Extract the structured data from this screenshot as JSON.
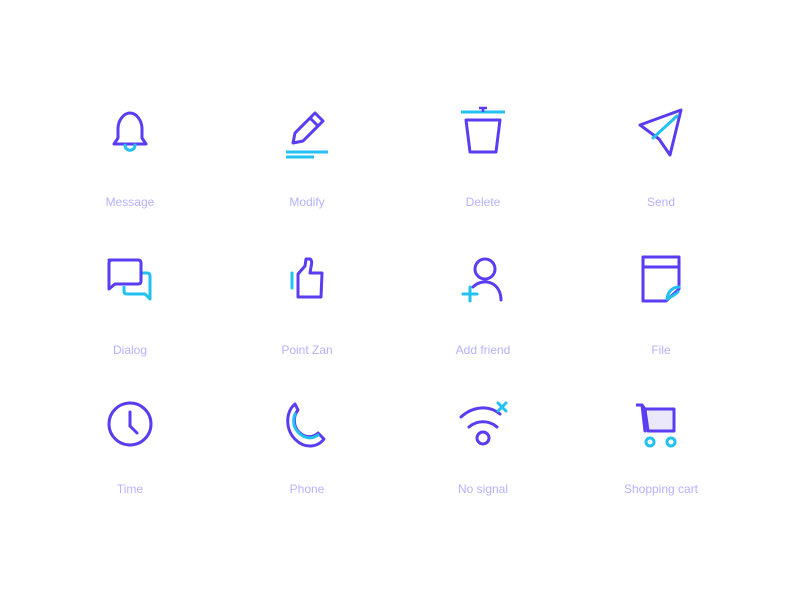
{
  "colors": {
    "primary": "#5a3cf2",
    "accent": "#22c1f1",
    "label": "#b6b1ff",
    "background": "#ffffff"
  },
  "icons": [
    {
      "icon": "bell-icon",
      "label": "Message"
    },
    {
      "icon": "pencil-icon",
      "label": "Modify"
    },
    {
      "icon": "trash-icon",
      "label": "Delete"
    },
    {
      "icon": "paper-plane-icon",
      "label": "Send"
    },
    {
      "icon": "chat-bubbles-icon",
      "label": "Dialog"
    },
    {
      "icon": "thumbs-up-icon",
      "label": "Point Zan"
    },
    {
      "icon": "add-user-icon",
      "label": "Add friend"
    },
    {
      "icon": "file-icon",
      "label": "File"
    },
    {
      "icon": "clock-icon",
      "label": "Time"
    },
    {
      "icon": "phone-icon",
      "label": "Phone"
    },
    {
      "icon": "no-signal-icon",
      "label": "No signal"
    },
    {
      "icon": "shopping-cart-icon",
      "label": "Shopping cart"
    }
  ]
}
